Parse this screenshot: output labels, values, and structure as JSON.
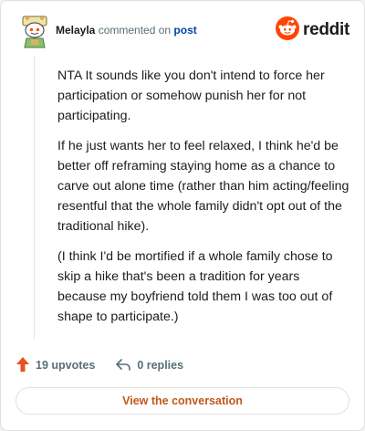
{
  "header": {
    "username": "Melayla",
    "action_text": " commented on ",
    "link_text": "post",
    "brand": "reddit"
  },
  "comment": {
    "paragraphs": [
      "NTA It sounds like you don't intend to force her participation or somehow punish her for not participating.",
      "If he just wants her to feel relaxed, I think he'd be better off reframing staying home as a chance to carve out alone time (rather than him acting/feeling resentful that the whole family didn't opt out of the traditional hike).",
      "(I think I'd be mortified if a whole family chose to skip a hike that's been a tradition for years because my boyfriend told them I was too out of shape to participate.)"
    ]
  },
  "actions": {
    "upvotes": "19 upvotes",
    "replies": "0 replies"
  },
  "cta": {
    "label": "View the conversation"
  },
  "colors": {
    "upvote": "#e8501f",
    "reddit_orange": "#ff4500",
    "link": "#0045ac",
    "cta_text": "#c25818"
  },
  "icons": {
    "avatar": "snoo-avatar-icon",
    "brand": "reddit-logo-icon",
    "upvote": "upvote-arrow-icon",
    "reply": "reply-arrow-icon"
  }
}
